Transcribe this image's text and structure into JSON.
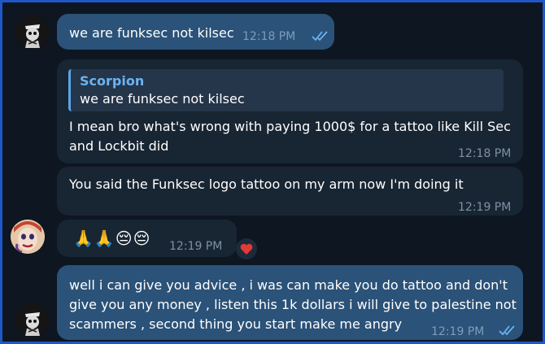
{
  "messages": [
    {
      "text": "we are funksec not kilsec",
      "time": "12:18 PM"
    },
    {
      "reply_name": "Scorpion",
      "reply_text": "we are funksec not kilsec",
      "lines": [
        "I mean bro what's wrong with paying 1000$ for a tattoo like Kill Sec",
        "and Lockbit did"
      ],
      "time": "12:18 PM"
    },
    {
      "text": "You said the Funksec logo tattoo on my arm now I'm doing it",
      "time": "12:19 PM"
    },
    {
      "emojis": "🙏🙏😔😔",
      "time": "12:19 PM",
      "reaction": "❤️"
    },
    {
      "lines": [
        "well i can give you advice , i was can make you do tattoo and don't",
        "give you any money , listen this 1k dollars i will give to palestine not",
        "scammers , second thing you start make me angry"
      ],
      "time": "12:19 PM"
    }
  ],
  "icons": {
    "read_receipt": "double-check-icon",
    "avatar_self": "skull-avatar-icon",
    "avatar_other": "clown-avatar-icon",
    "reaction": "heart-icon"
  },
  "colors": {
    "border": "#1f57c8",
    "background": "#0e1621",
    "outgoing_bubble": "#2b5278",
    "incoming_bubble": "#182533",
    "reply_accent": "#6ab3f3",
    "timestamp": "#7f91a4"
  }
}
